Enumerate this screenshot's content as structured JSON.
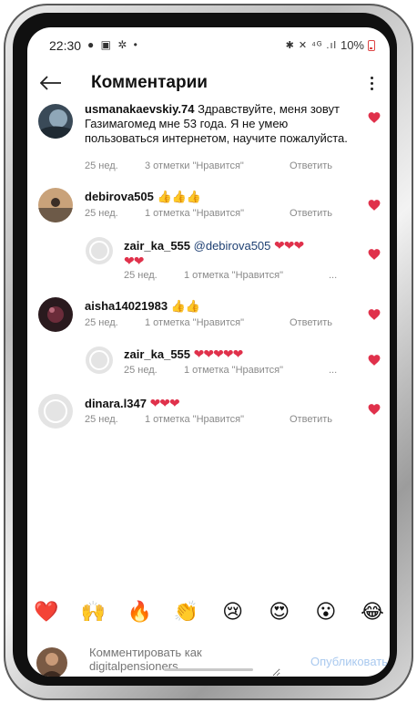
{
  "status_bar": {
    "time": "22:30",
    "left_icons": "● ▣ ✲ •",
    "system_icons": "✱ ✕ ⁴ᴳ .ıl",
    "battery": "10%"
  },
  "header": {
    "title": "Комментарии"
  },
  "comments": [
    {
      "username": "usmanakaevskiy.74",
      "text": "Здравствуйте, меня зовут Газимагомед мне 53 года. Я не умею пользоваться интернетом, научите пожалуйста.",
      "time": "25 нед.",
      "likes": "3 отметки \"Нравится\"",
      "reply": "Ответить"
    },
    {
      "username": "debirova505",
      "text": "👍👍👍",
      "time": "25 нед.",
      "likes": "1 отметка \"Нравится\"",
      "reply": "Ответить"
    },
    {
      "username": "zair_ka_555",
      "mention": "@debirova505",
      "text": "❤❤❤",
      "text2": "❤❤",
      "time": "25 нед.",
      "likes": "1 отметка \"Нравится\"",
      "more": "..."
    },
    {
      "username": "aisha14021983",
      "text": "👍👍",
      "time": "25 нед.",
      "likes": "1 отметка \"Нравится\"",
      "reply": "Ответить"
    },
    {
      "username": "zair_ka_555",
      "text": "❤❤❤❤❤",
      "time": "25 нед.",
      "likes": "1 отметка \"Нравится\"",
      "more": "..."
    },
    {
      "username": "dinara.l347",
      "text": "❤❤❤",
      "time": "25 нед.",
      "likes": "1 отметка \"Нравится\"",
      "reply": "Ответить"
    }
  ],
  "emoji_bar": [
    "❤️",
    "🙌",
    "🔥",
    "👏",
    "😢",
    "😍",
    "😮",
    "😂"
  ],
  "composer": {
    "placeholder": "Комментировать как digitalpensioners...",
    "publish_label": "Опубликовать"
  },
  "colors": {
    "heart": "#e0314b",
    "publish": "#a9c9ef",
    "meta": "#8a8a8a"
  }
}
